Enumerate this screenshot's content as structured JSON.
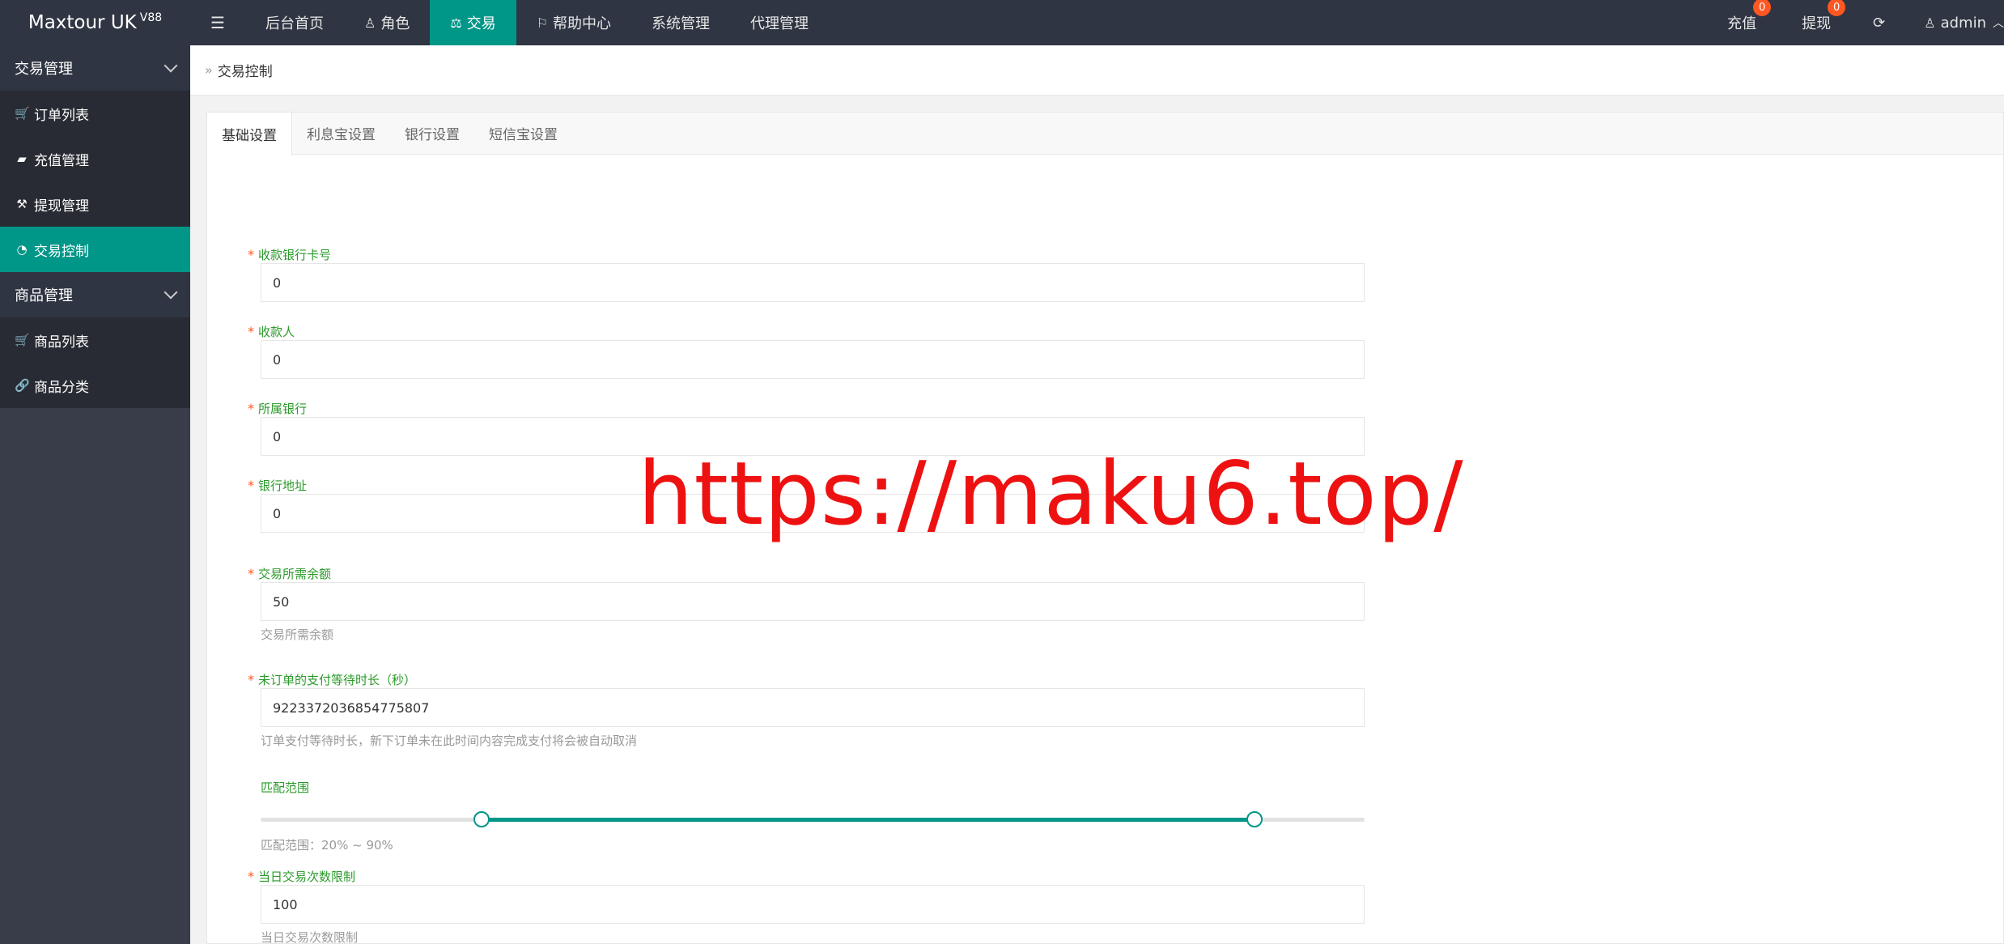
{
  "header": {
    "logo": "Maxtour UK",
    "logo_version": "V88",
    "nav": [
      {
        "label": "后台首页"
      },
      {
        "label": "角色"
      },
      {
        "label": "交易"
      },
      {
        "label": "帮助中心"
      },
      {
        "label": "系统管理"
      },
      {
        "label": "代理管理"
      }
    ],
    "recharge_label": "充值",
    "recharge_badge": "0",
    "withdraw_label": "提现",
    "withdraw_badge": "0",
    "user_label": "admin"
  },
  "sidebar": {
    "group1_title": "交易管理",
    "group1_items": [
      {
        "label": "订单列表"
      },
      {
        "label": "充值管理"
      },
      {
        "label": "提现管理"
      },
      {
        "label": "交易控制"
      }
    ],
    "group2_title": "商品管理",
    "group2_items": [
      {
        "label": "商品列表"
      },
      {
        "label": "商品分类"
      }
    ]
  },
  "breadcrumb": "交易控制",
  "tabs": [
    {
      "label": "基础设置"
    },
    {
      "label": "利息宝设置"
    },
    {
      "label": "银行设置"
    },
    {
      "label": "短信宝设置"
    }
  ],
  "form": {
    "bank_card": {
      "label": "收款银行卡号",
      "value": "0"
    },
    "payee": {
      "label": "收款人",
      "value": "0"
    },
    "bank": {
      "label": "所属银行",
      "value": "0"
    },
    "bank_address": {
      "label": "银行地址",
      "value": "0"
    },
    "min_balance": {
      "label": "交易所需余额",
      "value": "50",
      "help": "交易所需余额"
    },
    "pay_wait": {
      "label": "未订单的支付等待时长（秒）",
      "value": "9223372036854775807",
      "help": "订单支付等待时长，新下订单未在此时间内容完成支付将会被自动取消"
    },
    "match_range": {
      "label": "匹配范围",
      "help": "匹配范围：20% ~ 90%",
      "min": 20,
      "max": 90
    },
    "daily_limit": {
      "label": "当日交易次数限制",
      "value": "100",
      "help": "当日交易次数限制"
    }
  },
  "watermark": "https://maku6.top/",
  "colors": {
    "accent": "#009688",
    "header_bg": "#2f3542",
    "sidebar_bg": "#393d49",
    "badge": "#ff5722",
    "label_green": "#2a9a2a"
  }
}
